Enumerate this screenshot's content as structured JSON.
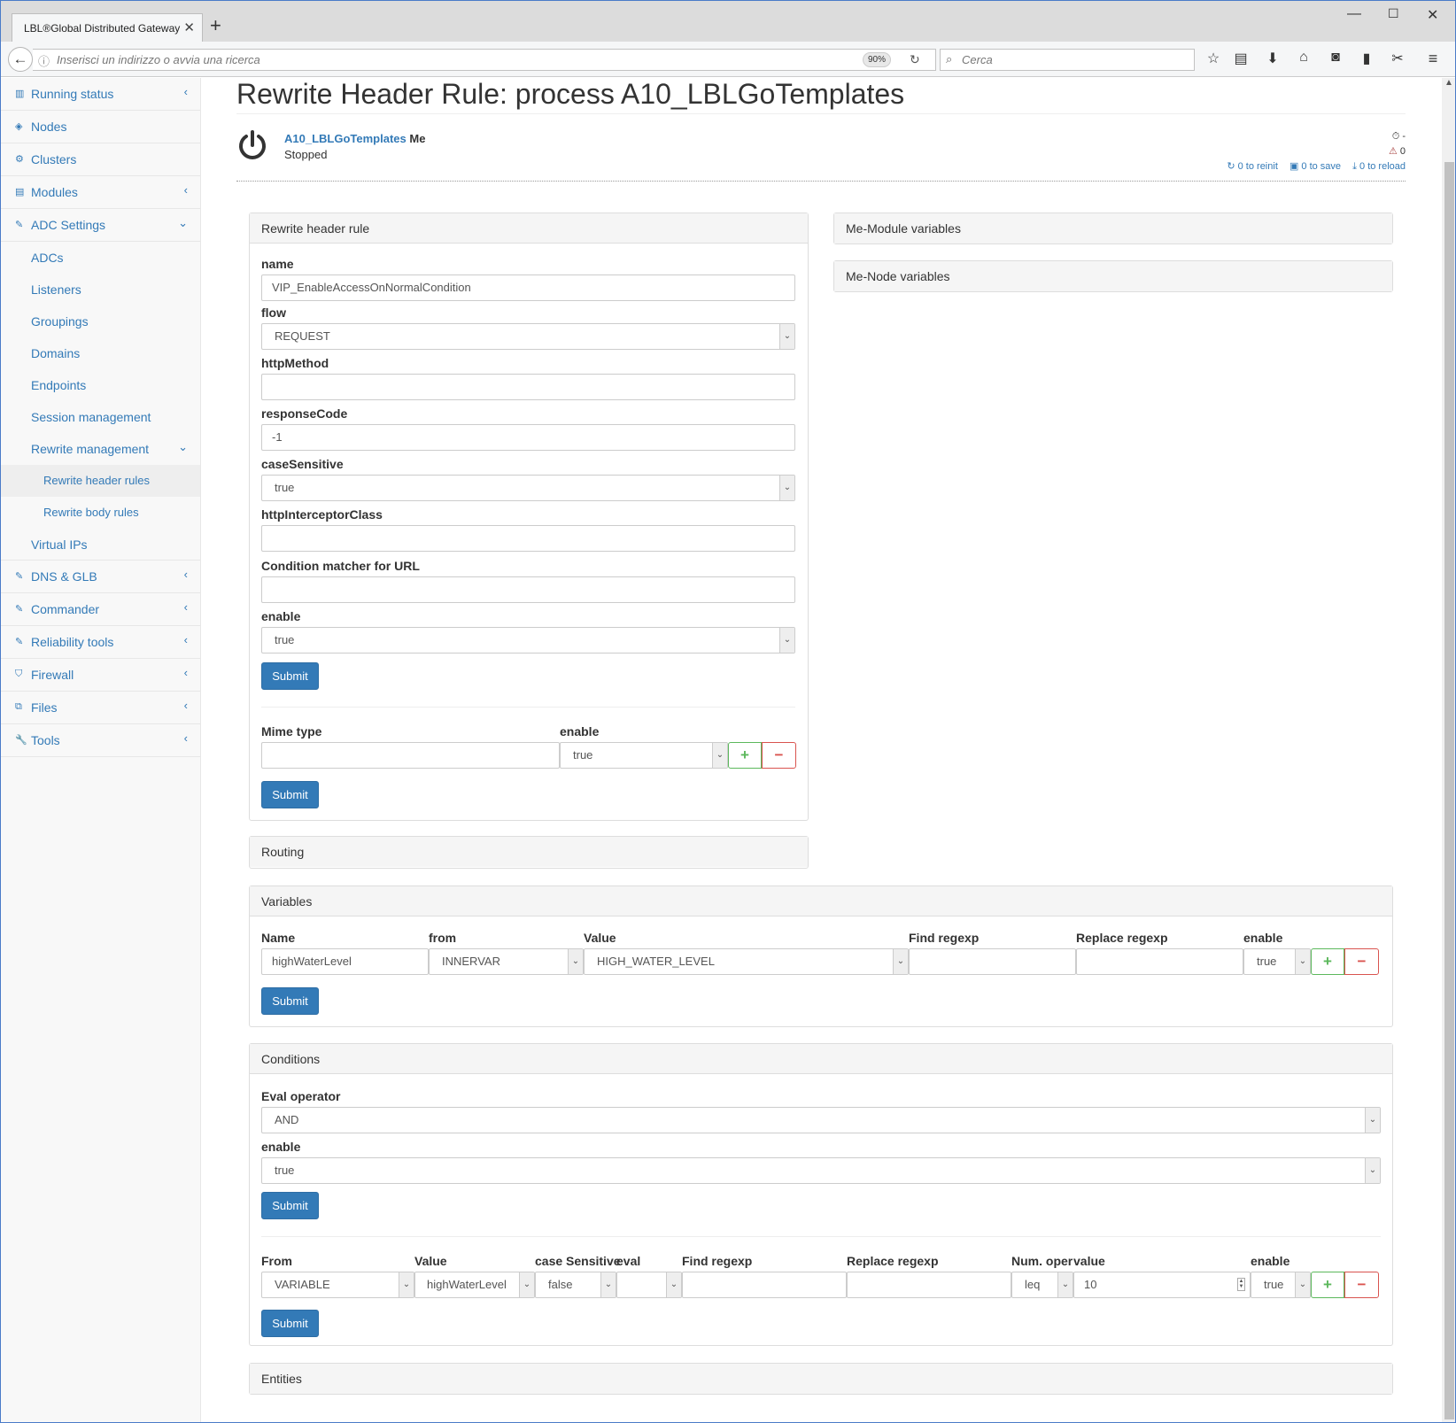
{
  "browser": {
    "tab_title": "LBL®Global Distributed Gateway",
    "url_placeholder": "Inserisci un indirizzo o avvia una ricerca",
    "zoom": "90%",
    "search_placeholder": "Cerca"
  },
  "sidebar": {
    "running_status": "Running status",
    "nodes": "Nodes",
    "clusters": "Clusters",
    "modules": "Modules",
    "adc_settings": "ADC Settings",
    "adcs": "ADCs",
    "listeners": "Listeners",
    "groupings": "Groupings",
    "domains": "Domains",
    "endpoints": "Endpoints",
    "session_management": "Session management",
    "rewrite_management": "Rewrite management",
    "rewrite_header_rules": "Rewrite header rules",
    "rewrite_body_rules": "Rewrite body rules",
    "virtual_ips": "Virtual IPs",
    "dns_glb": "DNS & GLB",
    "commander": "Commander",
    "reliability_tools": "Reliability tools",
    "firewall": "Firewall",
    "files": "Files",
    "tools": "Tools"
  },
  "page": {
    "title": "Rewrite Header Rule: process A10_LBLGoTemplates",
    "process_name": "A10_LBLGoTemplates",
    "process_suffix": "Me",
    "process_status": "Stopped",
    "stat_time": "-",
    "stat_warnings": "0",
    "to_reinit": "0 to reinit",
    "to_save": "0 to save",
    "to_reload": "0 to reload"
  },
  "rule_panel": {
    "heading": "Rewrite header rule",
    "name_label": "name",
    "name_value": "VIP_EnableAccessOnNormalCondition",
    "flow_label": "flow",
    "flow_value": "REQUEST",
    "httpmethod_label": "httpMethod",
    "httpmethod_value": "",
    "responsecode_label": "responseCode",
    "responsecode_value": "-1",
    "casesensitive_label": "caseSensitive",
    "casesensitive_value": "true",
    "interceptor_label": "httpInterceptorClass",
    "interceptor_value": "",
    "condition_url_label": "Condition matcher for URL",
    "condition_url_value": "",
    "enable_label": "enable",
    "enable_value": "true",
    "submit": "Submit",
    "mime_label": "Mime type",
    "mime_value": "",
    "mime_enable_label": "enable",
    "mime_enable_value": "true",
    "mime_submit": "Submit"
  },
  "right_panels": {
    "module_vars": "Me-Module variables",
    "node_vars": "Me-Node variables"
  },
  "routing": {
    "heading": "Routing"
  },
  "variables": {
    "heading": "Variables",
    "headers": {
      "name": "Name",
      "from": "from",
      "value": "Value",
      "find": "Find regexp",
      "replace": "Replace regexp",
      "enable": "enable"
    },
    "row": {
      "name": "highWaterLevel",
      "from": "INNERVAR",
      "value": "HIGH_WATER_LEVEL",
      "find": "",
      "replace": "",
      "enable": "true"
    },
    "submit": "Submit"
  },
  "conditions": {
    "heading": "Conditions",
    "eval_label": "Eval operator",
    "eval_value": "AND",
    "enable_label": "enable",
    "enable_value": "true",
    "submit": "Submit",
    "headers": {
      "from": "From",
      "value": "Value",
      "case": "case Sensitive",
      "eval": "eval",
      "find": "Find regexp",
      "replace": "Replace regexp",
      "numoper": "Num. oper",
      "val": "value",
      "enable": "enable"
    },
    "row": {
      "from": "VARIABLE",
      "value": "highWaterLevel",
      "case": "false",
      "eval": "",
      "find": "",
      "replace": "",
      "numoper": "leq",
      "val": "10",
      "enable": "true"
    },
    "row_submit": "Submit"
  },
  "entities": {
    "heading": "Entities"
  },
  "colors": {
    "brand": "#337ab7",
    "plus": "#5cb85c",
    "minus": "#d9534f"
  }
}
